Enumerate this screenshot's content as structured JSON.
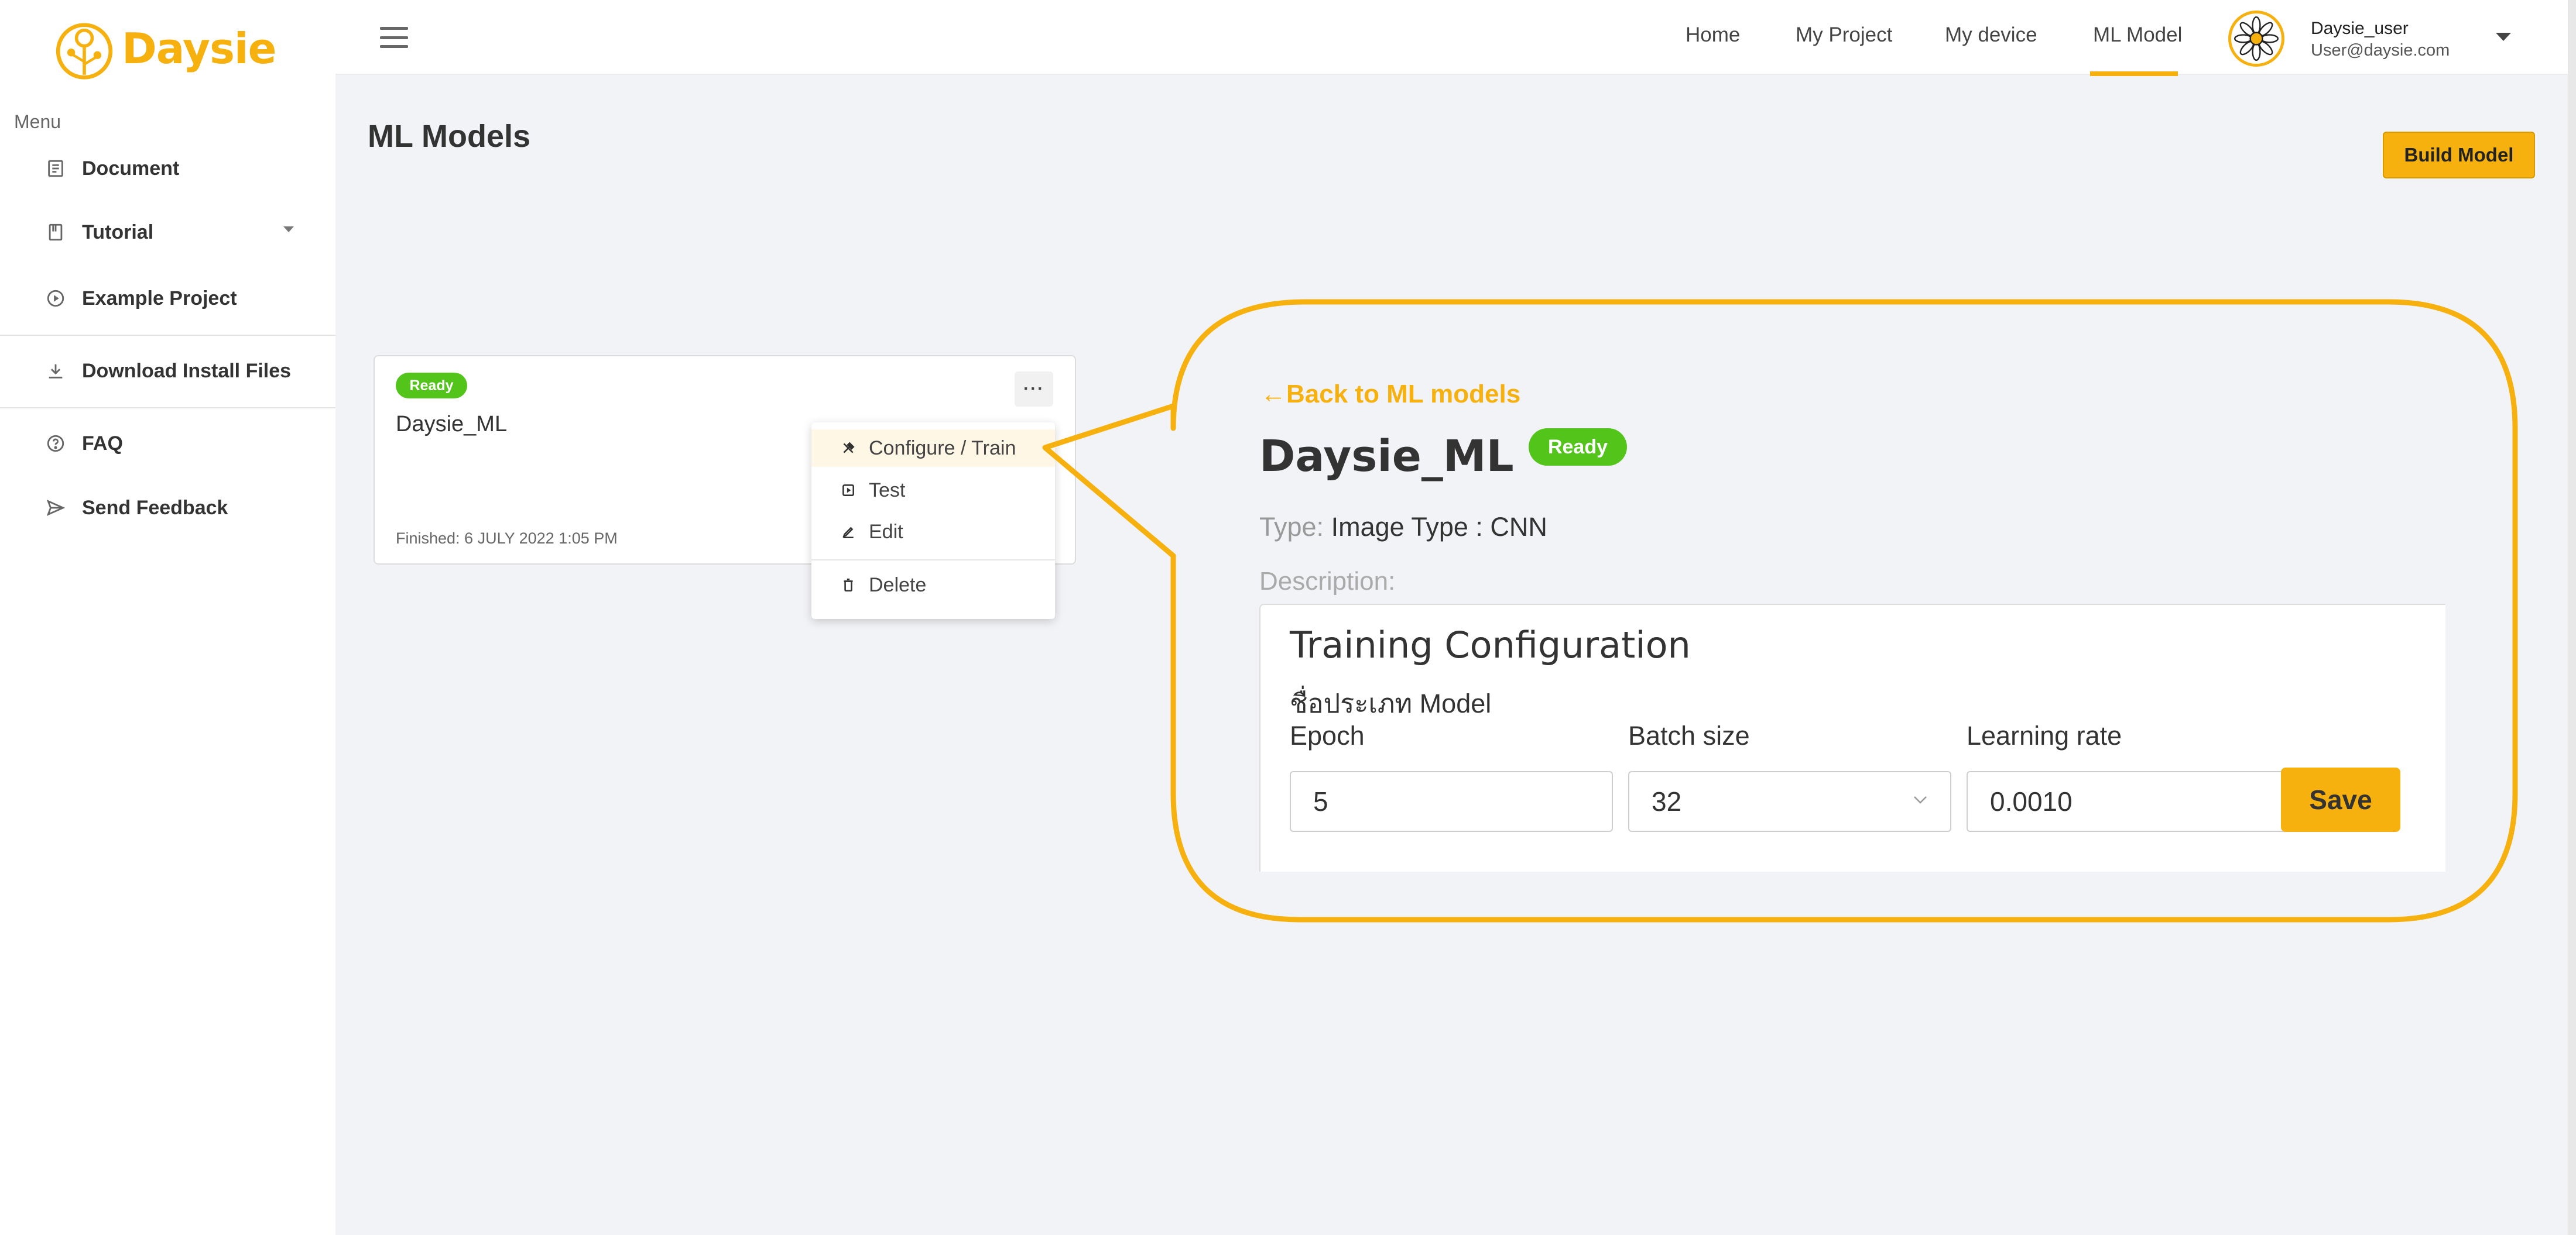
{
  "brand": {
    "name": "Daysie",
    "color": "#f6b10f"
  },
  "sidebar": {
    "menu_label": "Menu",
    "items": [
      {
        "label": "Document",
        "icon": "document-icon"
      },
      {
        "label": "Tutorial",
        "icon": "book-icon",
        "has_submenu": true
      },
      {
        "label": "Example Project",
        "icon": "play-circle-icon"
      },
      {
        "label": "Download Install Files",
        "icon": "download-icon"
      },
      {
        "label": "FAQ",
        "icon": "question-circle-icon"
      },
      {
        "label": "Send Feedback",
        "icon": "send-icon"
      }
    ]
  },
  "topbar": {
    "nav": [
      {
        "label": "Home",
        "active": false
      },
      {
        "label": "My Project",
        "active": false
      },
      {
        "label": "My device",
        "active": false
      },
      {
        "label": "ML Model",
        "active": true
      }
    ],
    "user": {
      "name": "Daysie_user",
      "email": "User@daysie.com"
    }
  },
  "main": {
    "title": "ML Models",
    "build_button": "Build Model",
    "card": {
      "status": "Ready",
      "name": "Daysie_ML",
      "finished": "Finished: 6 JULY 2022 1:05 PM",
      "more_label": "···"
    },
    "dropdown": [
      {
        "label": "Configure / Train",
        "icon": "tools-icon",
        "active": true
      },
      {
        "label": "Test",
        "icon": "test-icon",
        "active": false
      },
      {
        "label": "Edit",
        "icon": "edit-icon",
        "active": false
      },
      {
        "label": "Delete",
        "icon": "trash-icon",
        "active": false
      }
    ]
  },
  "zoom": {
    "back_label": "Back to ML models",
    "title": "Daysie_ML",
    "status": "Ready",
    "type_label": "Type:",
    "type_value": "Image Type : CNN",
    "description_label": "Description:",
    "config": {
      "title": "Training Configuration",
      "subtitle": "ชื่อประเภท Model",
      "epoch_label": "Epoch",
      "epoch_value": "5",
      "batch_label": "Batch size",
      "batch_value": "32",
      "lr_label": "Learning rate",
      "lr_value": "0.0010",
      "save_label": "Save"
    }
  },
  "colors": {
    "accent": "#f6b10f",
    "ready": "#52c41a"
  }
}
